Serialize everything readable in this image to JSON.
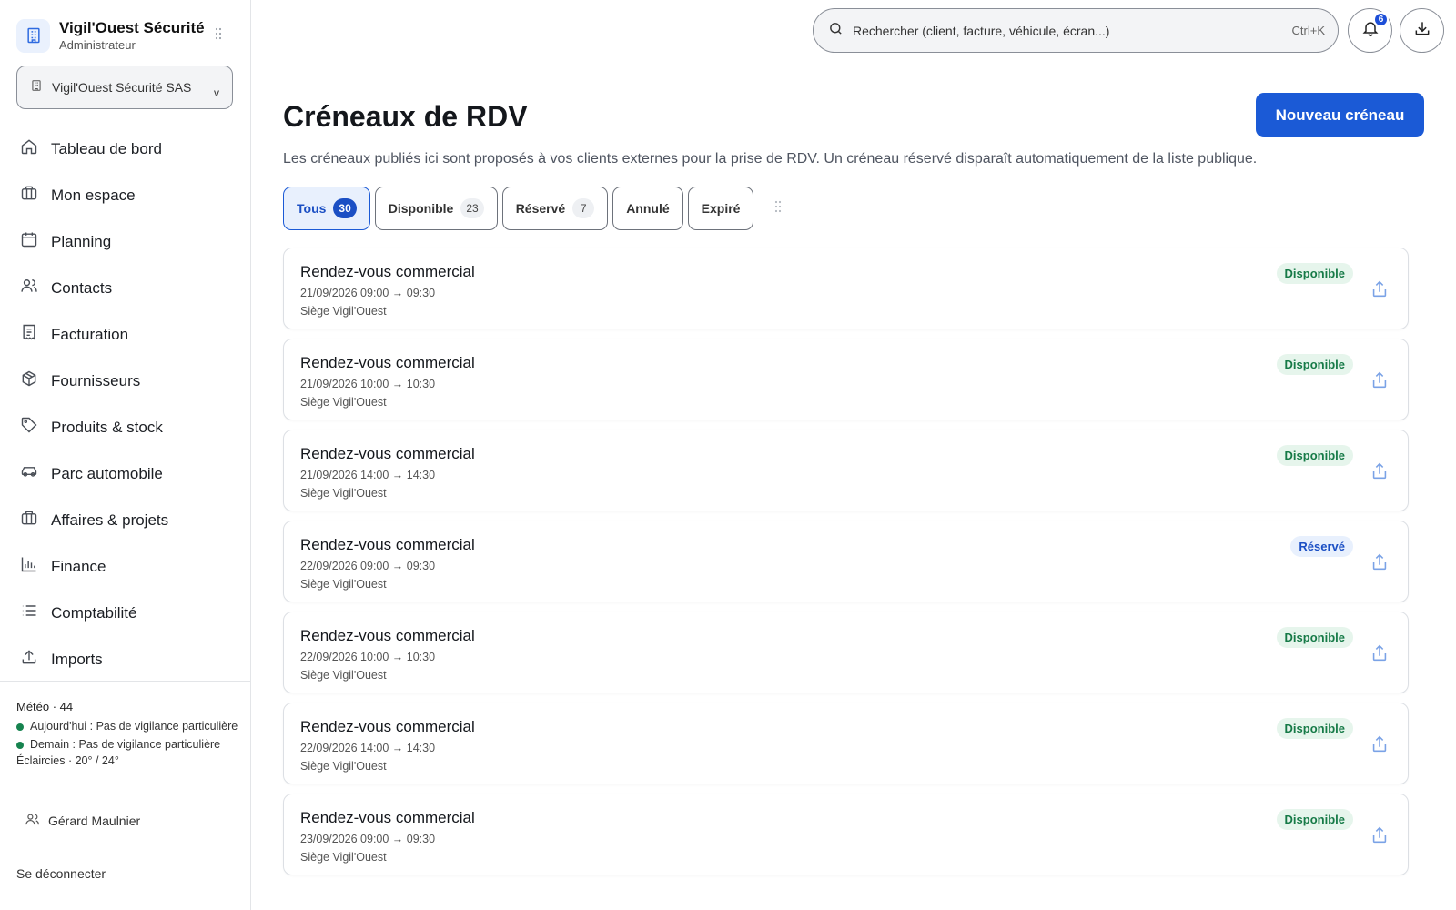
{
  "sidebar": {
    "brand": {
      "name": "Vigil'Ouest Sécurité",
      "role": "Administrateur",
      "icon": "building-icon"
    },
    "org_selector": {
      "value": "Vigil'Ouest Sécurité SAS",
      "chevron": "v"
    },
    "items": [
      {
        "label": "Tableau de bord",
        "icon": "home-icon"
      },
      {
        "label": "Mon espace",
        "icon": "briefcase-icon"
      },
      {
        "label": "Planning",
        "icon": "calendar-icon"
      },
      {
        "label": "Contacts",
        "icon": "users-icon"
      },
      {
        "label": "Facturation",
        "icon": "receipt-icon"
      },
      {
        "label": "Fournisseurs",
        "icon": "box-icon"
      },
      {
        "label": "Produits & stock",
        "icon": "tag-icon"
      },
      {
        "label": "Parc automobile",
        "icon": "car-icon"
      },
      {
        "label": "Affaires & projets",
        "icon": "briefcase-icon"
      },
      {
        "label": "Finance",
        "icon": "bar-chart-icon"
      },
      {
        "label": "Comptabilité",
        "icon": "list-icon"
      },
      {
        "label": "Imports",
        "icon": "upload-icon"
      }
    ],
    "weather": {
      "title": "Météo · 44",
      "today": "Aujourd'hui : Pas de vigilance particulière",
      "tomorrow": "Demain : Pas de vigilance particulière",
      "conditions": "Éclaircies · 20° / 24°",
      "status_color": "#16834f"
    },
    "user": {
      "name": "Gérard Maulnier"
    },
    "logout": "Se déconnecter"
  },
  "topbar": {
    "search": {
      "placeholder": "Rechercher (client, facture, véhicule, écran...)",
      "shortcut": "Ctrl+K"
    },
    "notifications": {
      "count": "6",
      "icon": "bell-icon"
    },
    "download": {
      "icon": "download-icon"
    }
  },
  "main": {
    "title": "Créneaux de RDV",
    "new_button": "Nouveau créneau",
    "description": "Les créneaux publiés ici sont proposés à vos clients externes pour la prise de RDV. Un créneau réservé disparaît automatiquement de la liste publique.",
    "filters": [
      {
        "label": "Tous",
        "count": "30",
        "active": true
      },
      {
        "label": "Disponible",
        "count": "23",
        "active": false
      },
      {
        "label": "Réservé",
        "count": "7",
        "active": false
      },
      {
        "label": "Annulé",
        "count": "",
        "active": false
      },
      {
        "label": "Expiré",
        "count": "",
        "active": false
      }
    ],
    "slots": [
      {
        "title": "Rendez-vous commercial",
        "time": "21/09/2026 09:00 → 09:30",
        "location": "Siège Vigil'Ouest",
        "status": "Disponible",
        "status_kind": "available"
      },
      {
        "title": "Rendez-vous commercial",
        "time": "21/09/2026 10:00 → 10:30",
        "location": "Siège Vigil'Ouest",
        "status": "Disponible",
        "status_kind": "available"
      },
      {
        "title": "Rendez-vous commercial",
        "time": "21/09/2026 14:00 → 14:30",
        "location": "Siège Vigil'Ouest",
        "status": "Disponible",
        "status_kind": "available"
      },
      {
        "title": "Rendez-vous commercial",
        "time": "22/09/2026 09:00 → 09:30",
        "location": "Siège Vigil'Ouest",
        "status": "Réservé",
        "status_kind": "reserved"
      },
      {
        "title": "Rendez-vous commercial",
        "time": "22/09/2026 10:00 → 10:30",
        "location": "Siège Vigil'Ouest",
        "status": "Disponible",
        "status_kind": "available"
      },
      {
        "title": "Rendez-vous commercial",
        "time": "22/09/2026 14:00 → 14:30",
        "location": "Siège Vigil'Ouest",
        "status": "Disponible",
        "status_kind": "available"
      },
      {
        "title": "Rendez-vous commercial",
        "time": "23/09/2026 09:00 → 09:30",
        "location": "Siège Vigil'Ouest",
        "status": "Disponible",
        "status_kind": "available"
      }
    ]
  },
  "colors": {
    "accent": "#1b5ad6",
    "available": "#167a47",
    "reserved": "#1b4fc4"
  }
}
